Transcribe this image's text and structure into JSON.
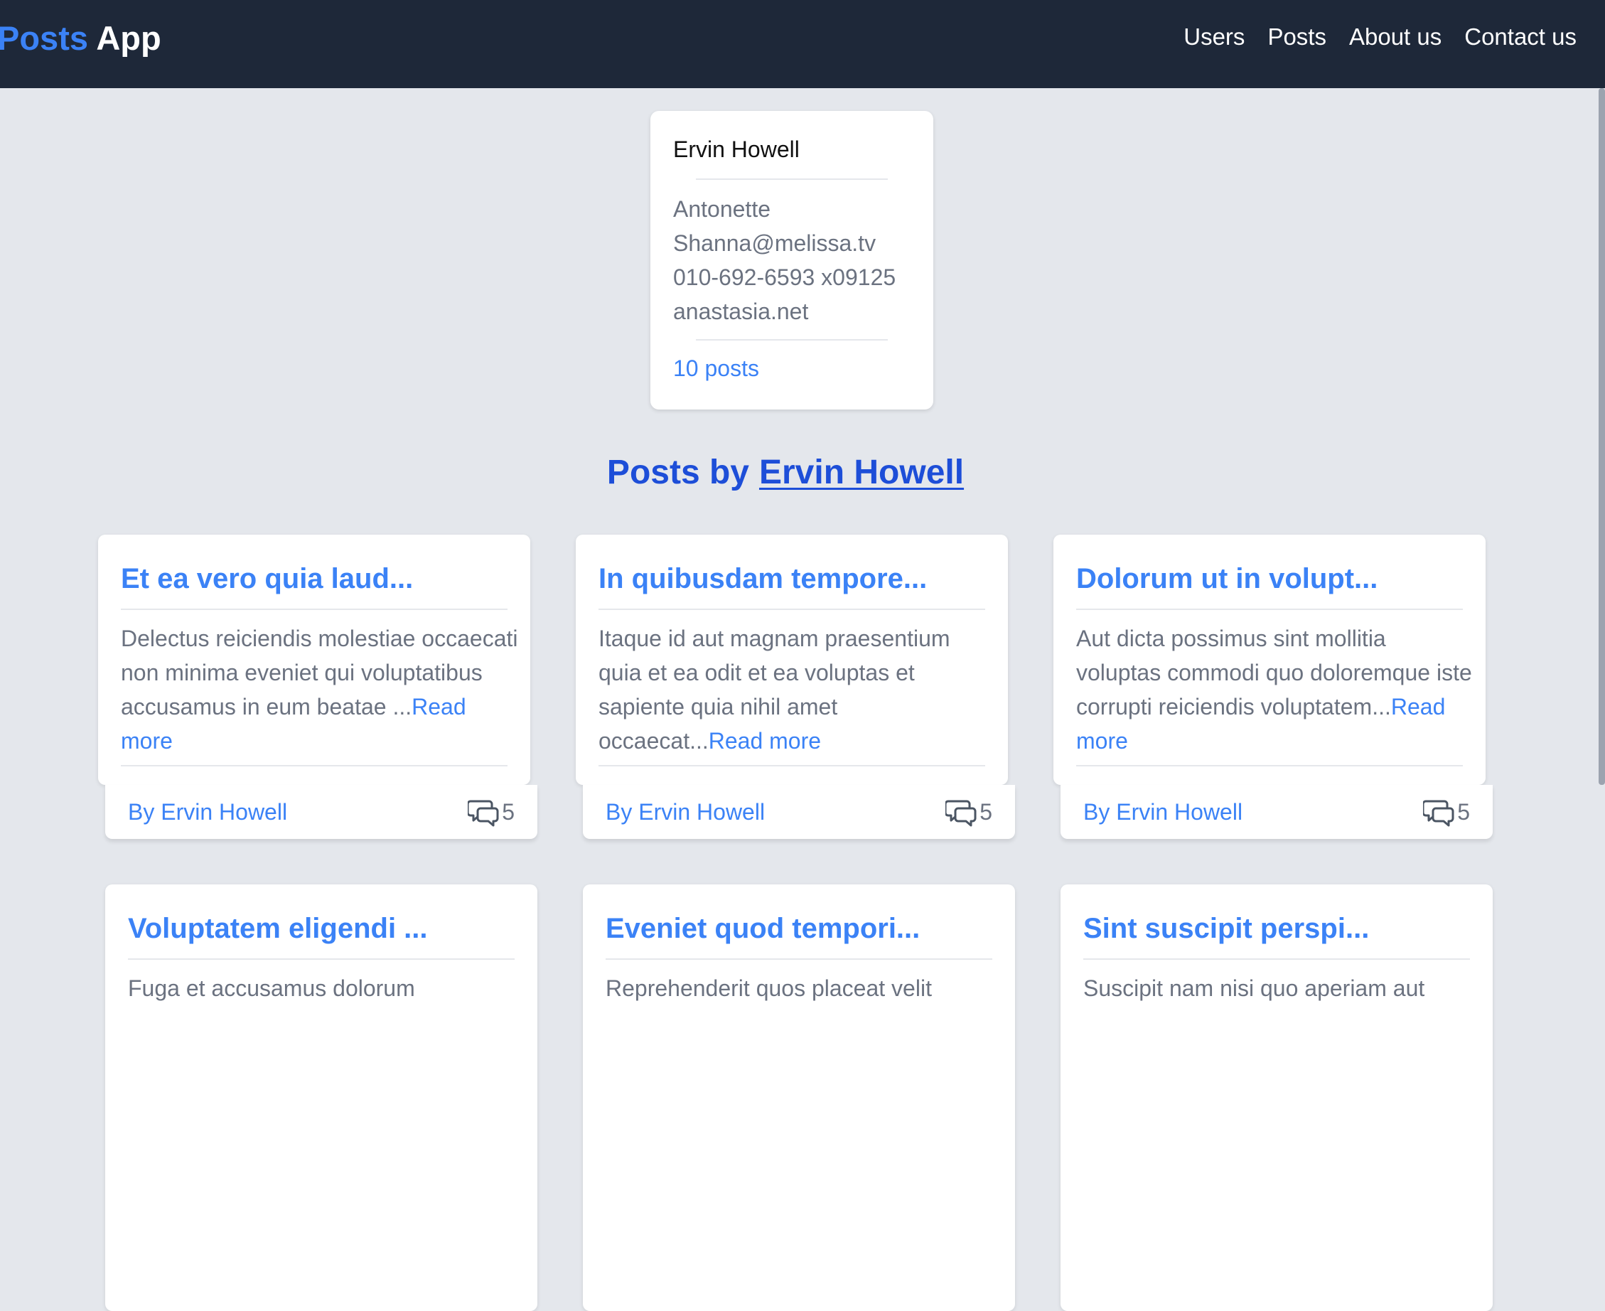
{
  "nav": {
    "brand_part1": "Posts",
    "brand_part2": "App",
    "links": [
      "Users",
      "Posts",
      "About us",
      "Contact us"
    ]
  },
  "user": {
    "name": "Ervin Howell",
    "username": "Antonette",
    "email": "Shanna@melissa.tv",
    "phone": "010-692-6593 x09125",
    "website": "anastasia.net",
    "posts_link": "10 posts"
  },
  "section": {
    "heading_prefix": "Posts by",
    "heading_author": "Ervin Howell"
  },
  "posts": [
    {
      "title": "Et ea vero quia laud...",
      "excerpt": "Delectus reiciendis molestiae occaecati non minima eveniet qui voluptatibus accusamus in eum beatae ...",
      "read_more": "Read more",
      "author": "By Ervin Howell",
      "comments": "5"
    },
    {
      "title": "In quibusdam tempore...",
      "excerpt": "Itaque id aut magnam praesentium quia et ea odit et ea voluptas et sapiente quia nihil amet occaecat...",
      "read_more": "Read more",
      "author": "By Ervin Howell",
      "comments": "5"
    },
    {
      "title": "Dolorum ut in volupt...",
      "excerpt": "Aut dicta possimus sint mollitia voluptas commodi quo doloremque iste corrupti reiciendis voluptatem...",
      "read_more": "Read more",
      "author": "By Ervin Howell",
      "comments": "5"
    },
    {
      "title": "Voluptatem eligendi ...",
      "excerpt": "Fuga et accusamus dolorum"
    },
    {
      "title": "Eveniet quod tempori...",
      "excerpt": "Reprehenderit quos placeat velit"
    },
    {
      "title": "Sint suscipit perspi...",
      "excerpt": "Suscipit nam nisi quo aperiam aut"
    }
  ],
  "colors": {
    "navbar_bg": "#1e2839",
    "page_bg": "#e4e7ec",
    "accent": "#3b82f6",
    "heading": "#1d4ed8",
    "muted_text": "#6b7280"
  }
}
